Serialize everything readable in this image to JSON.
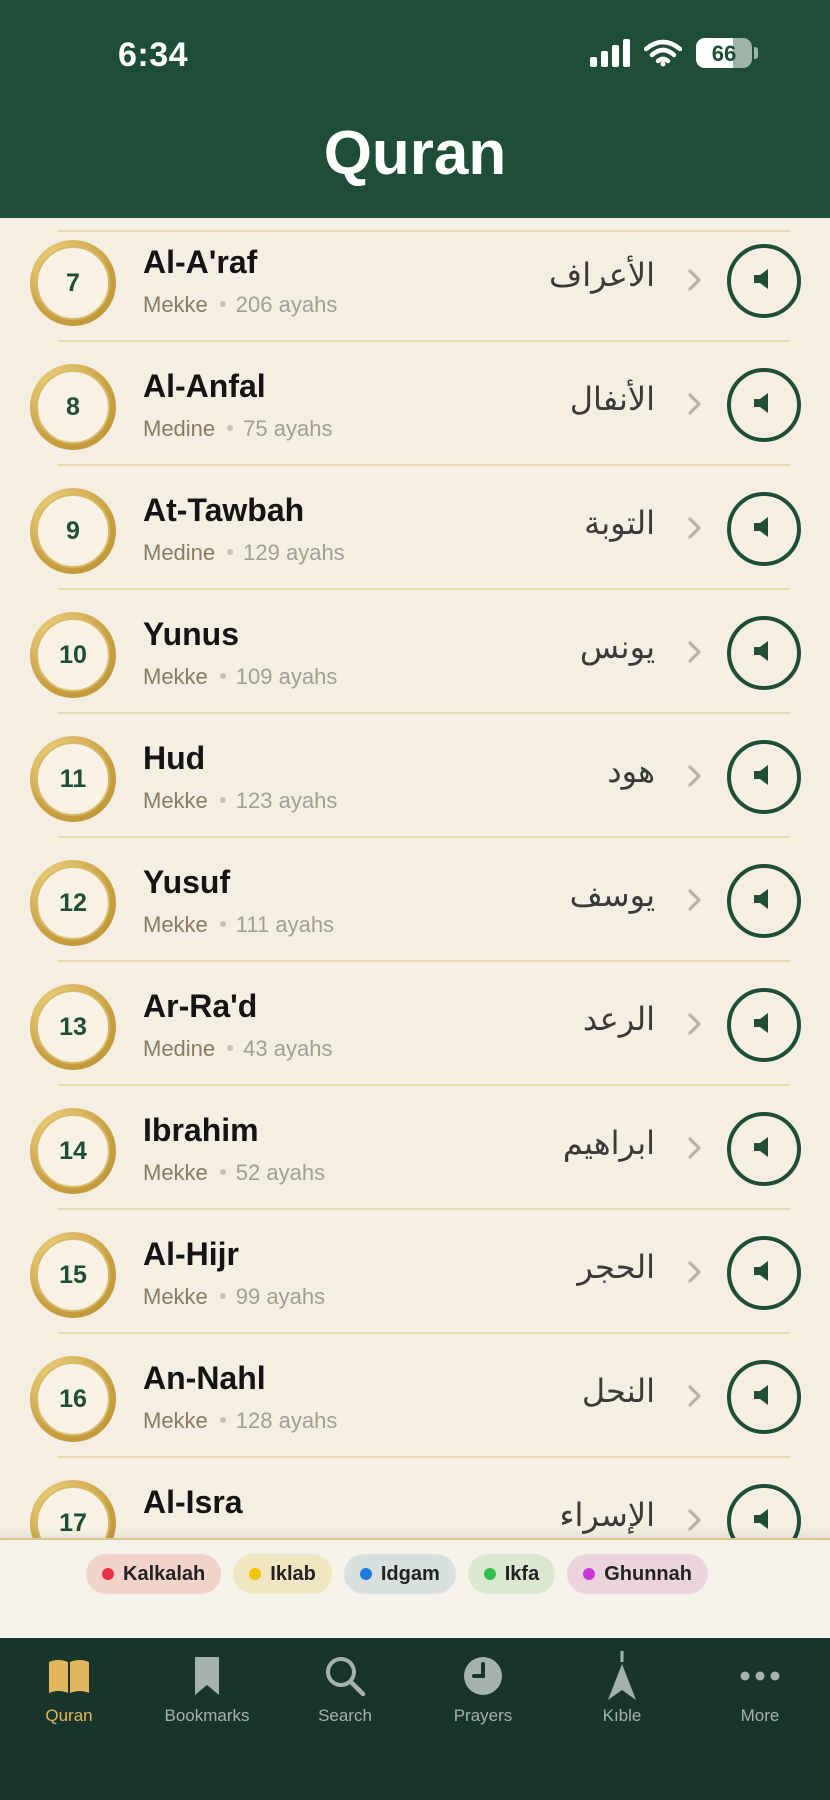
{
  "status_bar": {
    "time": "6:34",
    "battery": "66"
  },
  "header": {
    "title": "Quran"
  },
  "surahs": [
    {
      "number": "7",
      "name": "Al-A'raf",
      "place": "Mekke",
      "ayahs": "206 ayahs",
      "arabic": "الأعراف"
    },
    {
      "number": "8",
      "name": "Al-Anfal",
      "place": "Medine",
      "ayahs": "75 ayahs",
      "arabic": "الأنفال"
    },
    {
      "number": "9",
      "name": "At-Tawbah",
      "place": "Medine",
      "ayahs": "129 ayahs",
      "arabic": "التوبة"
    },
    {
      "number": "10",
      "name": "Yunus",
      "place": "Mekke",
      "ayahs": "109 ayahs",
      "arabic": "يونس"
    },
    {
      "number": "11",
      "name": "Hud",
      "place": "Mekke",
      "ayahs": "123 ayahs",
      "arabic": "هود"
    },
    {
      "number": "12",
      "name": "Yusuf",
      "place": "Mekke",
      "ayahs": "111 ayahs",
      "arabic": "يوسف"
    },
    {
      "number": "13",
      "name": "Ar-Ra'd",
      "place": "Medine",
      "ayahs": "43 ayahs",
      "arabic": "الرعد"
    },
    {
      "number": "14",
      "name": "Ibrahim",
      "place": "Mekke",
      "ayahs": "52 ayahs",
      "arabic": "ابراهيم"
    },
    {
      "number": "15",
      "name": "Al-Hijr",
      "place": "Mekke",
      "ayahs": "99 ayahs",
      "arabic": "الحجر"
    },
    {
      "number": "16",
      "name": "An-Nahl",
      "place": "Mekke",
      "ayahs": "128 ayahs",
      "arabic": "النحل"
    },
    {
      "number": "17",
      "name": "Al-Isra",
      "place": "",
      "ayahs": "",
      "arabic": "الإسراء"
    }
  ],
  "legend": [
    {
      "label": "Kalkalah",
      "dot": "#e8304a",
      "bg": "#f1d3ca"
    },
    {
      "label": "Iklab",
      "dot": "#f2c500",
      "bg": "#f1e6c2"
    },
    {
      "label": "Idgam",
      "dot": "#1f7ae0",
      "bg": "#d7e0df"
    },
    {
      "label": "Ikfa",
      "dot": "#2ec24a",
      "bg": "#dbe8cf"
    },
    {
      "label": "Ghunnah",
      "dot": "#c73ad6",
      "bg": "#ecd4de"
    }
  ],
  "tabs": [
    {
      "label": "Quran",
      "icon": "book-icon",
      "active": true
    },
    {
      "label": "Bookmarks",
      "icon": "bookmark-icon",
      "active": false
    },
    {
      "label": "Search",
      "icon": "search-icon",
      "active": false
    },
    {
      "label": "Prayers",
      "icon": "clock-icon",
      "active": false
    },
    {
      "label": "Kıble",
      "icon": "compass-icon",
      "active": false
    },
    {
      "label": "More",
      "icon": "more-icon",
      "active": false
    }
  ],
  "colors": {
    "primary": "#1e4d38",
    "accent": "#e2b75c",
    "background": "#f4efe2",
    "tabbar": "#17352a"
  }
}
